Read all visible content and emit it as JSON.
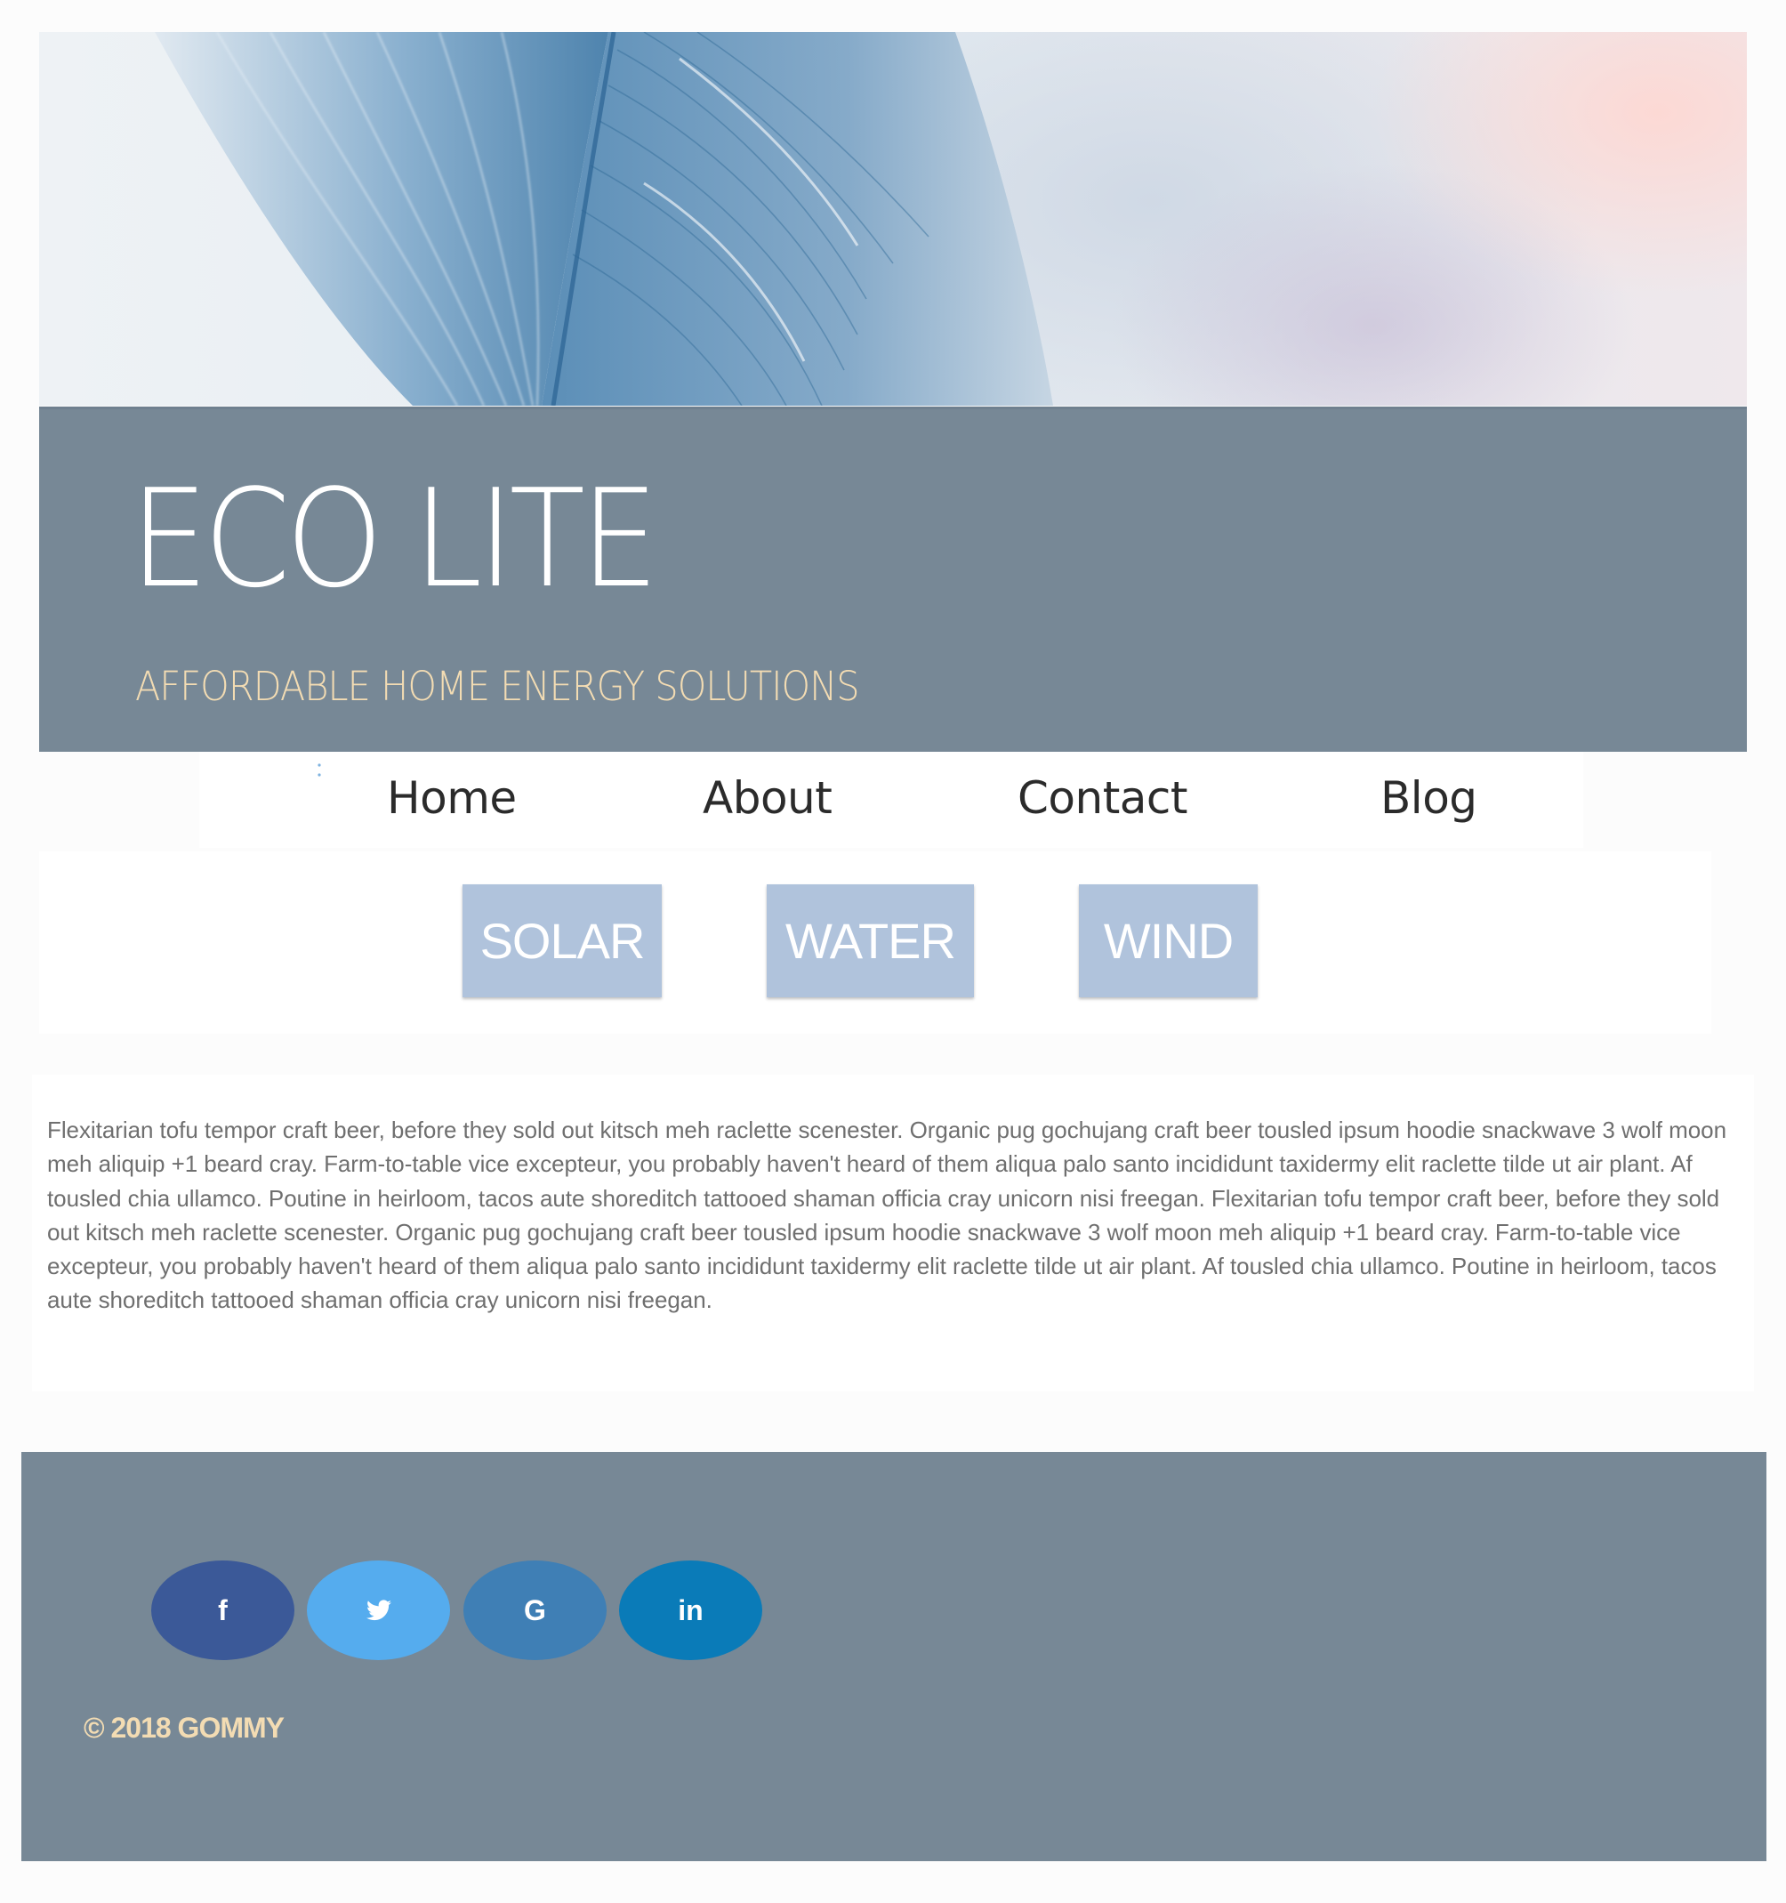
{
  "colors": {
    "banner": "#778896",
    "tagline": "#f3dcb3",
    "category_button": "#b0c3dc",
    "footer": "#778896",
    "facebook": "#3b5998",
    "twitter": "#55acee",
    "google": "#3f7fb5",
    "linkedin": "#0a7bb8"
  },
  "header": {
    "title": "ECO LITE",
    "tagline": "AFFORDABLE HOME ENERGY SOLUTIONS",
    "hero_image": "blue-feather-image"
  },
  "nav": {
    "items": [
      {
        "label": "Home"
      },
      {
        "label": "About"
      },
      {
        "label": "Contact"
      },
      {
        "label": "Blog"
      }
    ]
  },
  "categories": [
    {
      "label": "SOLAR"
    },
    {
      "label": "WATER"
    },
    {
      "label": "WIND"
    }
  ],
  "content": {
    "body": "Flexitarian tofu tempor craft beer, before they sold out kitsch meh raclette scenester. Organic pug gochujang craft beer tousled ipsum hoodie snackwave 3 wolf moon meh aliquip +1 beard cray. Farm-to-table vice excepteur, you probably haven't heard of them aliqua palo santo incididunt taxidermy elit raclette tilde ut air plant. Af tousled chia ullamco. Poutine in heirloom, tacos aute shoreditch tattooed shaman officia cray unicorn nisi freegan. Flexitarian tofu tempor craft beer, before they sold out kitsch meh raclette scenester. Organic pug gochujang craft beer tousled ipsum hoodie snackwave 3 wolf moon meh aliquip +1 beard cray. Farm-to-table vice excepteur, you probably haven't heard of them aliqua palo santo incididunt taxidermy elit raclette tilde ut air plant. Af tousled chia ullamco. Poutine in heirloom, tacos aute shoreditch tattooed shaman officia cray unicorn nisi freegan."
  },
  "footer": {
    "social": [
      {
        "name": "facebook",
        "icon": "facebook-icon",
        "glyph": "f"
      },
      {
        "name": "twitter",
        "icon": "twitter-icon",
        "glyph": ""
      },
      {
        "name": "google",
        "icon": "google-icon",
        "glyph": "G"
      },
      {
        "name": "linkedin",
        "icon": "linkedin-icon",
        "glyph": "in"
      }
    ],
    "copyright": "© 2018 GOMMY"
  }
}
